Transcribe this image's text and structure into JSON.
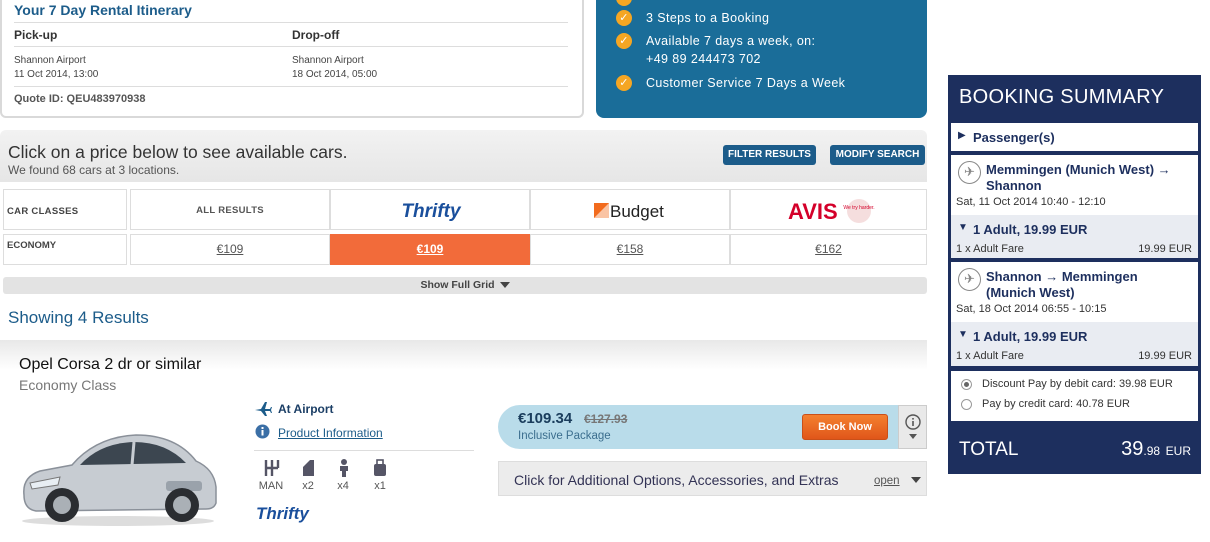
{
  "itinerary": {
    "title": "Your 7 Day Rental Itinerary",
    "pickup_label": "Pick-up",
    "dropoff_label": "Drop-off",
    "pickup_location": "Shannon Airport",
    "pickup_datetime": "11 Oct 2014, 13:00",
    "dropoff_location": "Shannon Airport",
    "dropoff_datetime": "18 Oct 2014, 05:00",
    "quote_id": "Quote ID: QEU483970938"
  },
  "promo": {
    "items": [
      "3 Steps to a Booking",
      "Available 7 days a week, on:",
      "Customer Service 7 Days a Week"
    ],
    "phone": "+49 89 244473 702"
  },
  "results_header": {
    "title": "Click on a price below to see available cars.",
    "subtitle": "We found 68 cars at 3 locations.",
    "filter_button": "FILTER RESULTS",
    "modify_button": "MODIFY SEARCH"
  },
  "grid": {
    "car_classes_label": "CAR CLASSES",
    "all_results_label": "ALL RESULTS",
    "vendors": [
      "Thrifty",
      "Budget",
      "AVIS"
    ],
    "avis_tagline": "We try harder.",
    "row_label": "ECONOMY",
    "prices": [
      "€109",
      "€109",
      "€158",
      "€162"
    ],
    "show_full_grid": "Show Full Grid"
  },
  "showing": "Showing 4 Results",
  "car": {
    "name": "Opel Corsa 2 dr or similar",
    "class": "Economy Class",
    "location": "At Airport",
    "product_info": "Product Information",
    "features": [
      "MAN",
      "x2",
      "x4",
      "x1"
    ],
    "vendor_logo": "Thrifty",
    "price": "€109.34",
    "old_price": "€127.93",
    "package": "Inclusive Package",
    "book_button": "Book Now",
    "options_text": "Click for Additional Options, Accessories, and Extras",
    "options_open": "open"
  },
  "summary": {
    "title": "BOOKING SUMMARY",
    "passengers": "Passenger(s)",
    "outbound": {
      "route": "Memmingen (Munich West) → Shannon",
      "datetime": "Sat, 11 Oct 2014 10:40 - 12:10",
      "fare_title": "1 Adult, 19.99 EUR",
      "fare_label": "1 x Adult Fare",
      "fare_value": "19.99 EUR"
    },
    "inbound": {
      "route": "Shannon → Memmingen (Munich West)",
      "datetime": "Sat, 18 Oct 2014 06:55 - 10:15",
      "fare_title": "1 Adult, 19.99 EUR",
      "fare_label": "1 x Adult Fare",
      "fare_value": "19.99 EUR"
    },
    "pay_debit": "Discount Pay by debit card: 39.98 EUR",
    "pay_credit": "Pay by credit card: 40.78 EUR",
    "total_label": "TOTAL",
    "total_int": "39",
    "total_dec": ".98",
    "total_cur": "EUR"
  }
}
